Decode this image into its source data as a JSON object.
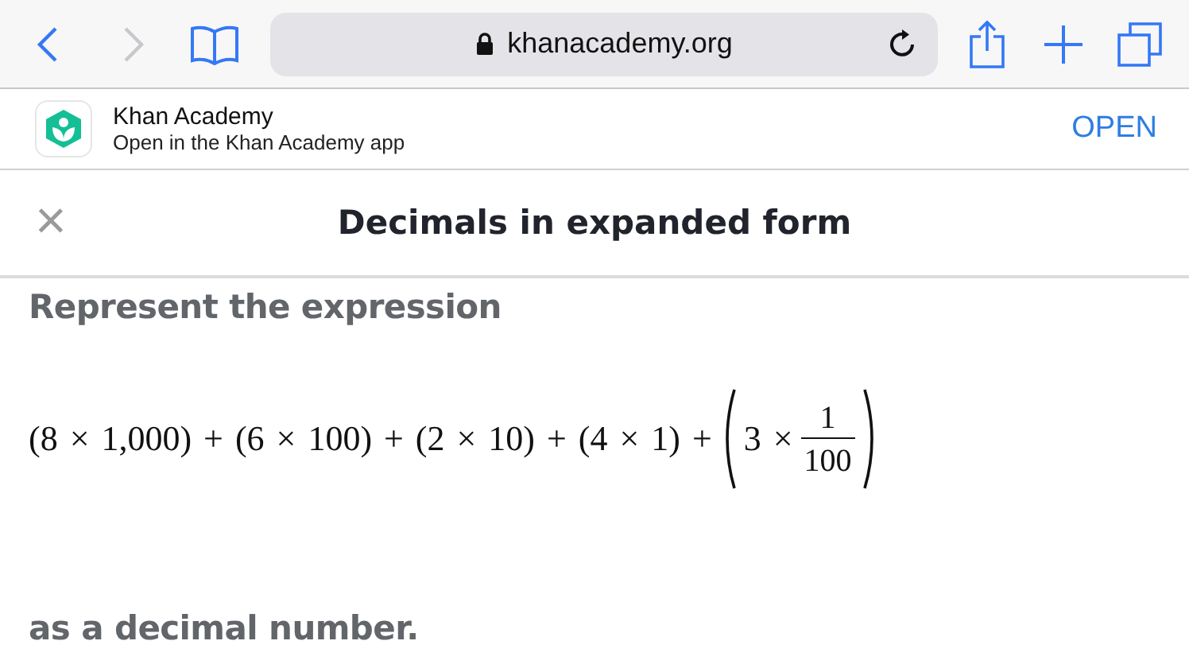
{
  "browser": {
    "url": "khanacademy.org"
  },
  "app_banner": {
    "name": "Khan Academy",
    "subtitle": "Open in the Khan Academy app",
    "action": "OPEN"
  },
  "header": {
    "close": "×",
    "title": "Decimals in expanded form"
  },
  "question": {
    "intro": "Represent the expression",
    "expression": "(8 × 1,000) + (6 × 100) + (2 × 10) + (4 × 1) +",
    "group_factor": "3 ×",
    "fraction": {
      "numerator": "1",
      "denominator": "100"
    },
    "outro": "as a decimal number."
  }
}
